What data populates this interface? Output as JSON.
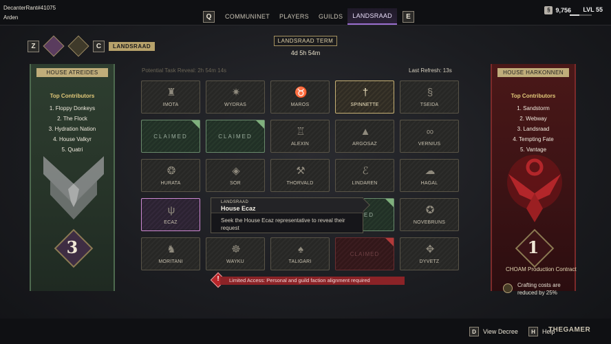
{
  "player": {
    "name": "DecanterRant#41075",
    "sub": "Arden"
  },
  "nav": {
    "key_left": "Q",
    "key_right": "E",
    "tabs": [
      {
        "label": "COMMUNINET",
        "active": false
      },
      {
        "label": "PLAYERS",
        "active": false
      },
      {
        "label": "GUILDS",
        "active": false
      },
      {
        "label": "LANDSRAAD",
        "active": true
      }
    ]
  },
  "currency": {
    "icon": "solari-icon",
    "value": "9,756"
  },
  "level": {
    "label": "LVL 55",
    "progress": 0.45
  },
  "left_header": {
    "key_left": "Z",
    "key_right": "C",
    "badge": "LANDSRAAD"
  },
  "term": {
    "label": "LANDSRAAD TERM",
    "time": "4d 5h 54m"
  },
  "potential": "Potential Task Reveal: 2h 54m 14s",
  "refresh": "Last Refresh: 13s",
  "atreides": {
    "house": "HOUSE ATREIDES",
    "contributors_title": "Top Contributors",
    "contributors": [
      "1. Floppy Donkeys",
      "2. The Flock",
      "3. Hydration Nation",
      "4. House Valkyr",
      "5. Quatri"
    ],
    "rank": "3",
    "color": "#3f5a42"
  },
  "harkonnen": {
    "house": "HOUSE HARKONNEN",
    "contributors_title": "Top Contributors",
    "contributors": [
      "1. Sandstorm",
      "2. Webway",
      "3. Landsraad",
      "4. Tempting Fate",
      "5. Vantage"
    ],
    "rank": "1",
    "color": "#7a1e1e",
    "reward_title": "CHOAM Production Contract",
    "reward_desc": "Crafting costs are reduced by 25%"
  },
  "tiles": [
    {
      "name": "IMOTA",
      "state": "normal",
      "glyph": "♜"
    },
    {
      "name": "WYDRAS",
      "state": "normal",
      "glyph": "✷"
    },
    {
      "name": "MAROS",
      "state": "normal",
      "glyph": "♉"
    },
    {
      "name": "SPINNETTE",
      "state": "selected",
      "glyph": "†"
    },
    {
      "name": "TSEIDA",
      "state": "normal",
      "glyph": "§"
    },
    {
      "name": "CLAIMED",
      "state": "claimed",
      "glyph": ""
    },
    {
      "name": "CLAIMED",
      "state": "claimed",
      "glyph": ""
    },
    {
      "name": "ALEXIN",
      "state": "normal",
      "glyph": "♖"
    },
    {
      "name": "ARGOSAZ",
      "state": "normal",
      "glyph": "▲"
    },
    {
      "name": "VERNIUS",
      "state": "normal",
      "glyph": "∞"
    },
    {
      "name": "HURATA",
      "state": "normal",
      "glyph": "❂"
    },
    {
      "name": "SOR",
      "state": "normal",
      "glyph": "◈"
    },
    {
      "name": "THORVALD",
      "state": "normal",
      "glyph": "⚒"
    },
    {
      "name": "LINDAREN",
      "state": "normal",
      "glyph": "ℰ"
    },
    {
      "name": "HAGAL",
      "state": "normal",
      "glyph": "☁"
    },
    {
      "name": "ECAZ",
      "state": "ecaz",
      "glyph": "ψ"
    },
    {
      "name": "",
      "state": "hidden",
      "glyph": ""
    },
    {
      "name": "",
      "state": "hidden",
      "glyph": ""
    },
    {
      "name": "IMED",
      "state": "claimed",
      "glyph": ""
    },
    {
      "name": "NOVEBRUNS",
      "state": "normal",
      "glyph": "✪"
    },
    {
      "name": "MORITANI",
      "state": "normal",
      "glyph": "♞"
    },
    {
      "name": "WAYKU",
      "state": "normal",
      "glyph": "☸"
    },
    {
      "name": "TALIGARI",
      "state": "normal",
      "glyph": "♠"
    },
    {
      "name": "CLAIMED",
      "state": "claimed-red",
      "glyph": ""
    },
    {
      "name": "DYVETZ",
      "state": "normal",
      "glyph": "✥"
    }
  ],
  "tooltip": {
    "sub": "LANDSRAAD",
    "title": "House Ecaz",
    "body": "Seek the House Ecaz representative to reveal their request"
  },
  "alert": "Limited Access: Personal and guild faction alignment required",
  "bottom": {
    "view_key": "D",
    "view_label": "View Decree",
    "help_key": "H",
    "help_label": "Help",
    "watermark": "THEGAMER"
  }
}
